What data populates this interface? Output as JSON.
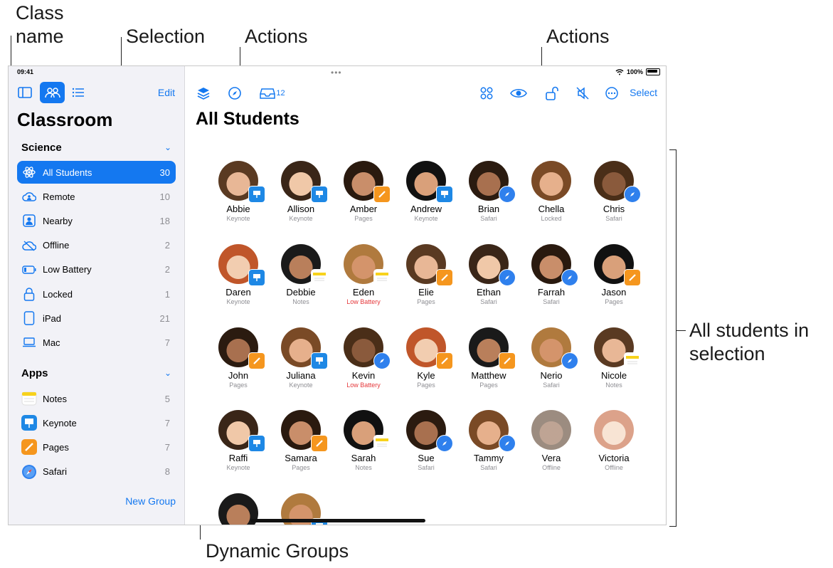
{
  "callouts": {
    "class_name": "Class\nname",
    "selection": "Selection",
    "actions_left": "Actions",
    "actions_right": "Actions",
    "all_students": "All students in\nselection",
    "dynamic_groups": "Dynamic Groups"
  },
  "status": {
    "time": "09:41",
    "battery": "100%"
  },
  "sidebar": {
    "edit_label": "Edit",
    "app_title": "Classroom",
    "class_section": "Science",
    "groups": [
      {
        "label": "All Students",
        "count": "30",
        "icon": "atom-icon",
        "selected": true
      },
      {
        "label": "Remote",
        "count": "10",
        "icon": "cloud-person-icon"
      },
      {
        "label": "Nearby",
        "count": "18",
        "icon": "person-badge-icon"
      },
      {
        "label": "Offline",
        "count": "2",
        "icon": "cloud-offline-icon"
      },
      {
        "label": "Low Battery",
        "count": "2",
        "icon": "low-battery-icon"
      },
      {
        "label": "Locked",
        "count": "1",
        "icon": "lock-icon"
      },
      {
        "label": "iPad",
        "count": "21",
        "icon": "ipad-icon"
      },
      {
        "label": "Mac",
        "count": "7",
        "icon": "laptop-icon"
      }
    ],
    "apps_section": "Apps",
    "apps": [
      {
        "label": "Notes",
        "count": "5",
        "icon": "notes-icon"
      },
      {
        "label": "Keynote",
        "count": "7",
        "icon": "keynote-icon"
      },
      {
        "label": "Pages",
        "count": "7",
        "icon": "pages-icon"
      },
      {
        "label": "Safari",
        "count": "8",
        "icon": "safari-icon"
      }
    ],
    "new_group_label": "New Group"
  },
  "toolbar": {
    "inbox_count": "12",
    "select_label": "Select"
  },
  "main": {
    "title": "All Students",
    "students": [
      {
        "name": "Abbie",
        "status": "Keynote",
        "badge": "keynote"
      },
      {
        "name": "Allison",
        "status": "Keynote",
        "badge": "keynote"
      },
      {
        "name": "Amber",
        "status": "Pages",
        "badge": "pages"
      },
      {
        "name": "Andrew",
        "status": "Keynote",
        "badge": "keynote"
      },
      {
        "name": "Brian",
        "status": "Safari",
        "badge": "safari"
      },
      {
        "name": "Chella",
        "status": "Locked",
        "badge": ""
      },
      {
        "name": "Chris",
        "status": "Safari",
        "badge": "safari"
      },
      {
        "name": "Daren",
        "status": "Keynote",
        "badge": "keynote"
      },
      {
        "name": "Debbie",
        "status": "Notes",
        "badge": "notes"
      },
      {
        "name": "Eden",
        "status": "Low Battery",
        "badge": "notes",
        "warn": true
      },
      {
        "name": "Elie",
        "status": "Pages",
        "badge": "pages"
      },
      {
        "name": "Ethan",
        "status": "Safari",
        "badge": "safari"
      },
      {
        "name": "Farrah",
        "status": "Safari",
        "badge": "safari"
      },
      {
        "name": "Jason",
        "status": "Pages",
        "badge": "pages"
      },
      {
        "name": "John",
        "status": "Pages",
        "badge": "pages"
      },
      {
        "name": "Juliana",
        "status": "Keynote",
        "badge": "keynote"
      },
      {
        "name": "Kevin",
        "status": "Low Battery",
        "badge": "safari",
        "warn": true
      },
      {
        "name": "Kyle",
        "status": "Pages",
        "badge": "pages"
      },
      {
        "name": "Matthew",
        "status": "Pages",
        "badge": "pages"
      },
      {
        "name": "Nerio",
        "status": "Safari",
        "badge": "safari"
      },
      {
        "name": "Nicole",
        "status": "Notes",
        "badge": "notes"
      },
      {
        "name": "Raffi",
        "status": "Keynote",
        "badge": "keynote"
      },
      {
        "name": "Samara",
        "status": "Pages",
        "badge": "pages"
      },
      {
        "name": "Sarah",
        "status": "Notes",
        "badge": "notes"
      },
      {
        "name": "Sue",
        "status": "Safari",
        "badge": "safari"
      },
      {
        "name": "Tammy",
        "status": "Safari",
        "badge": "safari"
      },
      {
        "name": "Vera",
        "status": "Offline",
        "badge": "",
        "faded": true
      },
      {
        "name": "Victoria",
        "status": "Offline",
        "badge": "",
        "faded": true
      },
      {
        "name": "",
        "status": "",
        "badge": ""
      },
      {
        "name": "",
        "status": "",
        "badge": "keynote"
      }
    ]
  },
  "colors": {
    "accent": "#1478f0",
    "keynote": "#1e88e5",
    "pages": "#f5961e",
    "safari": "#2f80ed",
    "notes": "#f7d21c"
  }
}
